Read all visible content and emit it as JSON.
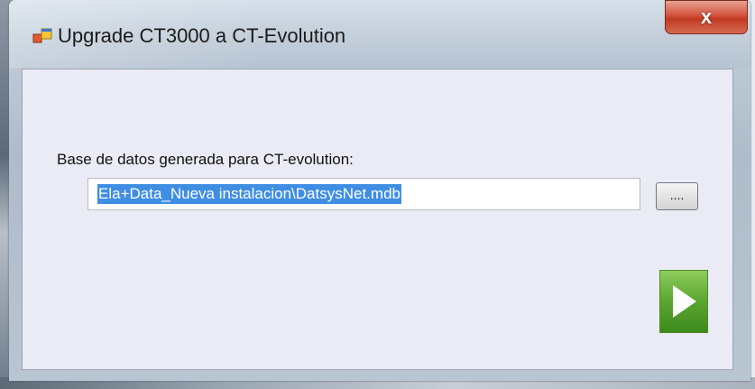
{
  "window": {
    "title": "Upgrade CT3000 a CT-Evolution",
    "close_label": "x"
  },
  "form": {
    "label": "Base de datos generada para CT-evolution:",
    "path_value": "Ela+Data_Nueva instalacion\\DatsysNet.mdb",
    "browse_label": "...."
  },
  "icons": {
    "app": "app-window-icon",
    "play": "play-arrow-icon"
  }
}
